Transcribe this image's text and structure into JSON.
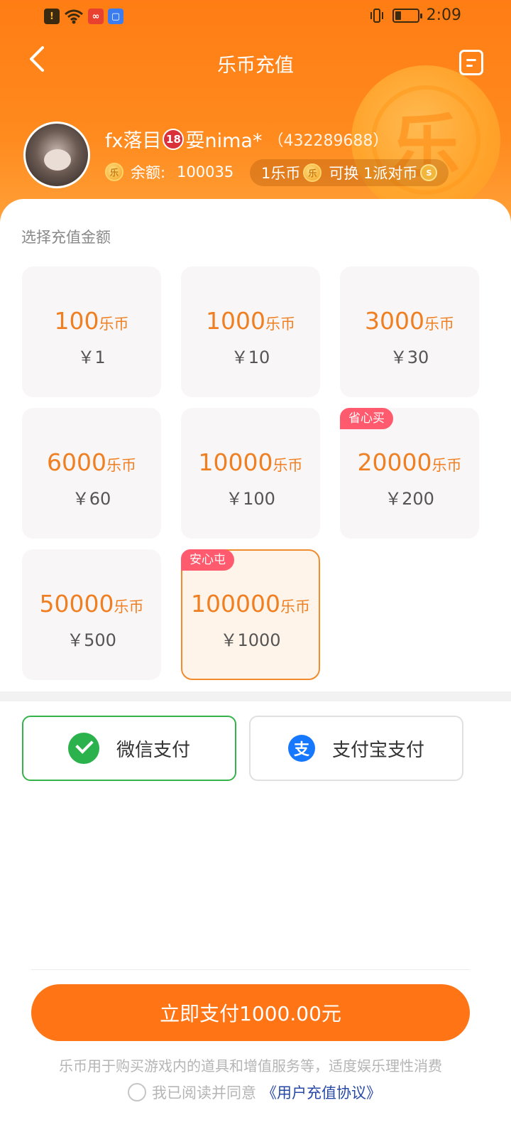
{
  "status_bar": {
    "time": "2:09",
    "left_icons": [
      "alert-icon",
      "wifi-icon",
      "app-icon",
      "app-store-icon"
    ],
    "right_icons": [
      "vibrate-icon",
      "battery-icon"
    ]
  },
  "nav": {
    "title": "乐币充值",
    "back_icon": "chevron-left-icon",
    "record_icon": "record-list-icon"
  },
  "user": {
    "name_part1": "fx落目",
    "badge": "18",
    "name_part2": "耍nima*",
    "uid": "（432289688）",
    "balance_label": "余额:",
    "balance_value": "100035",
    "rate_part1": "1乐币",
    "rate_part2": "可换 1派对币"
  },
  "coin_glyph": "乐",
  "section_label": "选择充值金额",
  "packages": [
    {
      "amount": "100",
      "unit": "乐币",
      "price": "￥1",
      "tag": "",
      "selected": false
    },
    {
      "amount": "1000",
      "unit": "乐币",
      "price": "￥10",
      "tag": "",
      "selected": false
    },
    {
      "amount": "3000",
      "unit": "乐币",
      "price": "￥30",
      "tag": "",
      "selected": false
    },
    {
      "amount": "6000",
      "unit": "乐币",
      "price": "￥60",
      "tag": "",
      "selected": false
    },
    {
      "amount": "10000",
      "unit": "乐币",
      "price": "￥100",
      "tag": "",
      "selected": false
    },
    {
      "amount": "20000",
      "unit": "乐币",
      "price": "￥200",
      "tag": "省心买",
      "selected": false
    },
    {
      "amount": "50000",
      "unit": "乐币",
      "price": "￥500",
      "tag": "",
      "selected": false
    },
    {
      "amount": "100000",
      "unit": "乐币",
      "price": "￥1000",
      "tag": "安心屯",
      "selected": true
    }
  ],
  "payment": {
    "wechat_label": "微信支付",
    "alipay_label": "支付宝支付",
    "alipay_glyph": "支",
    "selected": "wechat"
  },
  "pay_button": "立即支付1000.00元",
  "disclaimer": "乐币用于购买游戏内的道具和增值服务等，适度娱乐理性消费",
  "agreement": {
    "text": "我已阅读并同意",
    "link": "《用户充值协议》"
  },
  "colors": {
    "brand": "#ff7414",
    "selected_border": "#f08b2e",
    "wechat_green": "#36b24a",
    "tag_red": "#ff5a6e",
    "alipay_blue": "#1677ff"
  }
}
